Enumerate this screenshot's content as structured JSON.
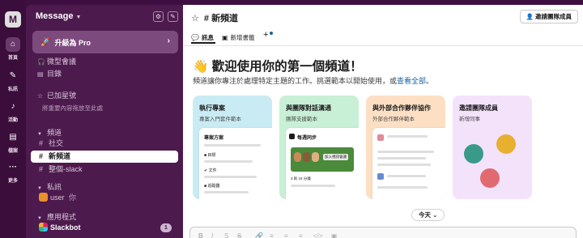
{
  "rail": {
    "workspace_initial": "M",
    "items": [
      {
        "icon": "home-icon",
        "glyph": "⌂",
        "label": "首頁"
      },
      {
        "icon": "dm-icon",
        "glyph": "✎",
        "label": "私訊"
      },
      {
        "icon": "bell-icon",
        "glyph": "♫",
        "label": "活動"
      },
      {
        "icon": "files-icon",
        "glyph": "▤",
        "label": "檔案"
      },
      {
        "icon": "more-icon",
        "glyph": "···",
        "label": "更多"
      }
    ]
  },
  "sidebar": {
    "workspace_name": "Message",
    "promo_label": "升級為 Pro",
    "huddles": "微型會議",
    "directory": "目錄",
    "starred_title": "已加星號",
    "starred_hint": "將重要內容拖放至此處",
    "channels_header": "頻道",
    "channels": [
      {
        "name": "社交",
        "active": false
      },
      {
        "name": "新頻道",
        "active": true
      },
      {
        "name": "整個-slack",
        "active": false
      }
    ],
    "dms_header": "私訊",
    "dm_user": "user",
    "dm_you": "你",
    "apps_header": "應用程式",
    "app_name": "Slackbot",
    "app_badge": "1"
  },
  "main": {
    "channel_title": "新頻道",
    "invite_label": "邀請團隊成員",
    "tabs": [
      "訊息",
      "新增書籤"
    ],
    "welcome_title": "歡迎使用你的第一個頻道！",
    "welcome_emoji": "👋",
    "welcome_desc": "頻道讓你專注於處理特定主題的工作。挑選範本以開始使用，或",
    "welcome_link": "查看全部",
    "welcome_end": "。",
    "cards": [
      {
        "title": "執行專案",
        "subtitle": "專案入門套件範本",
        "color": "#c9ecf4",
        "preview_title": "專案方案",
        "items": [
          "目標",
          "文件",
          "追蹤器"
        ]
      },
      {
        "title": "與團隊對話溝通",
        "subtitle": "團隊支援範本",
        "color": "#c8f0d6",
        "preview_title": "每週同步",
        "items": [
          "加入視訊會議",
          "3 則 15 分鐘"
        ]
      },
      {
        "title": "與外部合作夥伴協作",
        "subtitle": "外部合作夥伴範本",
        "color": "#fde0c4",
        "preview_title": "",
        "items": []
      },
      {
        "title": "邀請團隊成員",
        "subtitle": "新增同事",
        "color": "#f4e2fb",
        "preview_title": "",
        "items": []
      }
    ],
    "today_label": "今天",
    "format_icons": [
      "B",
      "I",
      "S",
      "🔗",
      "≡",
      "≡",
      "≡",
      "</>",
      "▣"
    ]
  }
}
